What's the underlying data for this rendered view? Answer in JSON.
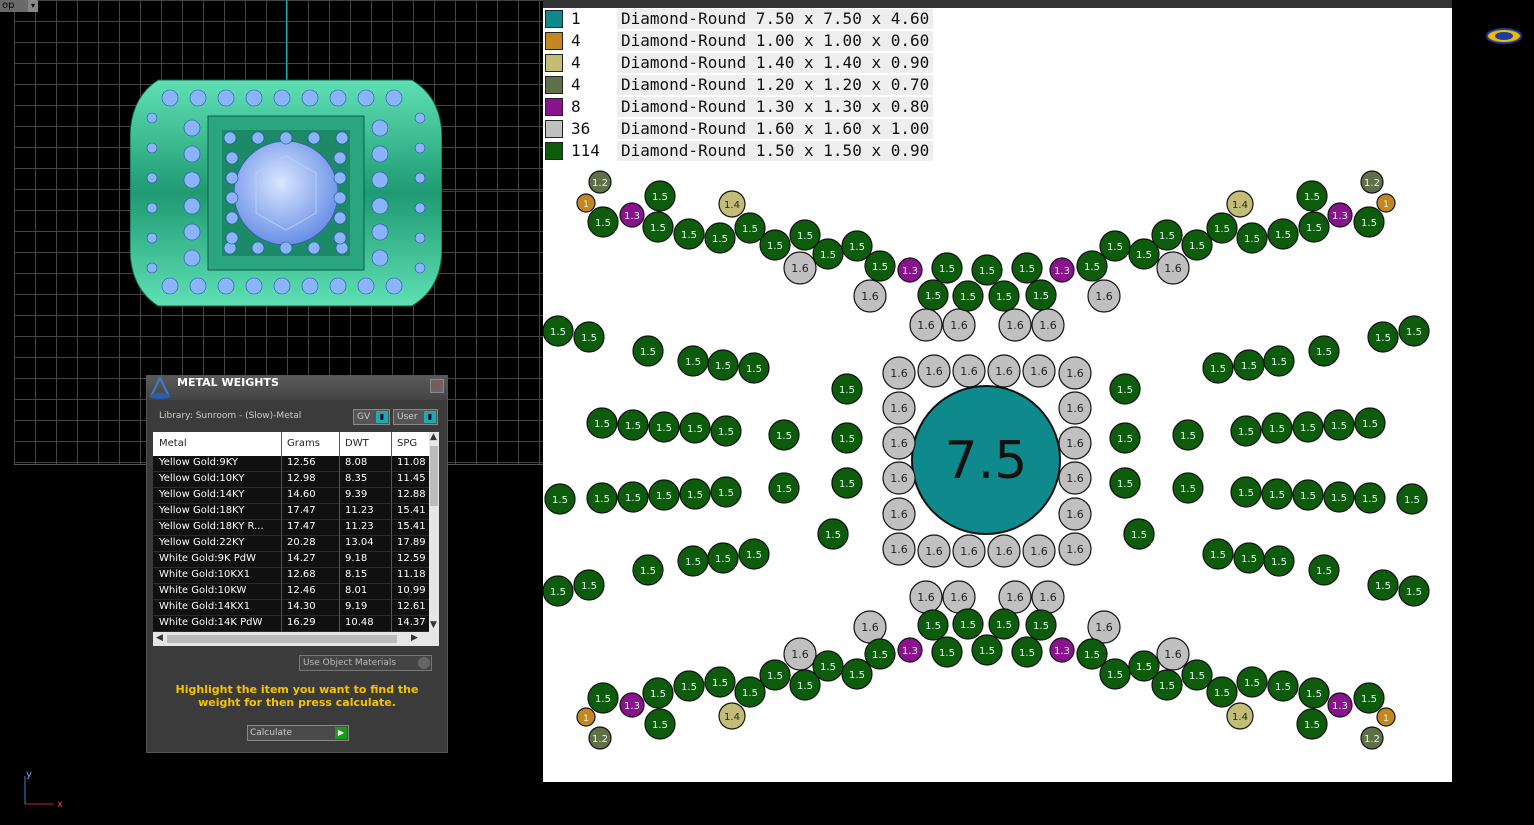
{
  "viewport": {
    "label": "op",
    "axis_y": "y",
    "axis_x": "x"
  },
  "metal_panel": {
    "title": "METAL WEIGHTS",
    "close": "✕",
    "library": "Library: Sunroom - (Slow)-Metal",
    "gv_label": "GV",
    "user_label": "User",
    "columns": [
      "Metal",
      "Grams",
      "DWT",
      "SPG"
    ],
    "rows": [
      [
        "Yellow Gold:9KY",
        "12.56",
        "8.08",
        "11.08"
      ],
      [
        "Yellow Gold:10KY",
        "12.98",
        "8.35",
        "11.45"
      ],
      [
        "Yellow Gold:14KY",
        "14.60",
        "9.39",
        "12.88"
      ],
      [
        "Yellow Gold:18KY",
        "17.47",
        "11.23",
        "15.41"
      ],
      [
        "Yellow Gold:18KY R...",
        "17.47",
        "11.23",
        "15.41"
      ],
      [
        "Yellow Gold:22KY",
        "20.28",
        "13.04",
        "17.89"
      ],
      [
        "White Gold:9K PdW",
        "14.27",
        "9.18",
        "12.59"
      ],
      [
        "White Gold:10KX1",
        "12.68",
        "8.15",
        "11.18"
      ],
      [
        "White Gold:10KW",
        "12.46",
        "8.01",
        "10.99"
      ],
      [
        "White Gold:14KX1",
        "14.30",
        "9.19",
        "12.61"
      ],
      [
        "White Gold:14K PdW",
        "16.29",
        "10.48",
        "14.37"
      ]
    ],
    "use_object_materials": "Use Object Materials",
    "hint": "Highlight the item you want to find the weight for then press calculate.",
    "calculate": "Calculate"
  },
  "legend": [
    {
      "count": "1",
      "desc": "Diamond-Round 7.50 x 7.50 x 4.60",
      "color": "#0e8a8c"
    },
    {
      "count": "4",
      "desc": "Diamond-Round 1.00 x 1.00 x 0.60",
      "color": "#c4861e"
    },
    {
      "count": "4",
      "desc": "Diamond-Round 1.40 x 1.40 x 0.90",
      "color": "#c2bc76"
    },
    {
      "count": "4",
      "desc": "Diamond-Round 1.20 x 1.20 x 0.70",
      "color": "#5f7048"
    },
    {
      "count": "8",
      "desc": "Diamond-Round 1.30 x 1.30 x 0.80",
      "color": "#8b128e"
    },
    {
      "count": "36",
      "desc": "Diamond-Round 1.60 x 1.60 x 1.00",
      "color": "#c0c0c0"
    },
    {
      "count": "114",
      "desc": "Diamond-Round 1.50 x 1.50 x 0.90",
      "color": "#0c5c0c"
    }
  ],
  "center_stone_label": "7.5",
  "stone_labels": {
    "s10": "1",
    "s14": "1.4",
    "s12": "1.2",
    "s13": "1.3",
    "s16": "1.6",
    "s15": "1.5"
  },
  "colors": {
    "center": "#0e8a8c",
    "s10": "#c4861e",
    "s14": "#c2bc76",
    "s12": "#5f7048",
    "s13": "#8b128e",
    "s16": "#c0c0c0",
    "s15": "#0c5c0c",
    "hint": "#f5c400",
    "ring_metal": "#3dbf94",
    "ring_stone": "#8ab4ff"
  }
}
